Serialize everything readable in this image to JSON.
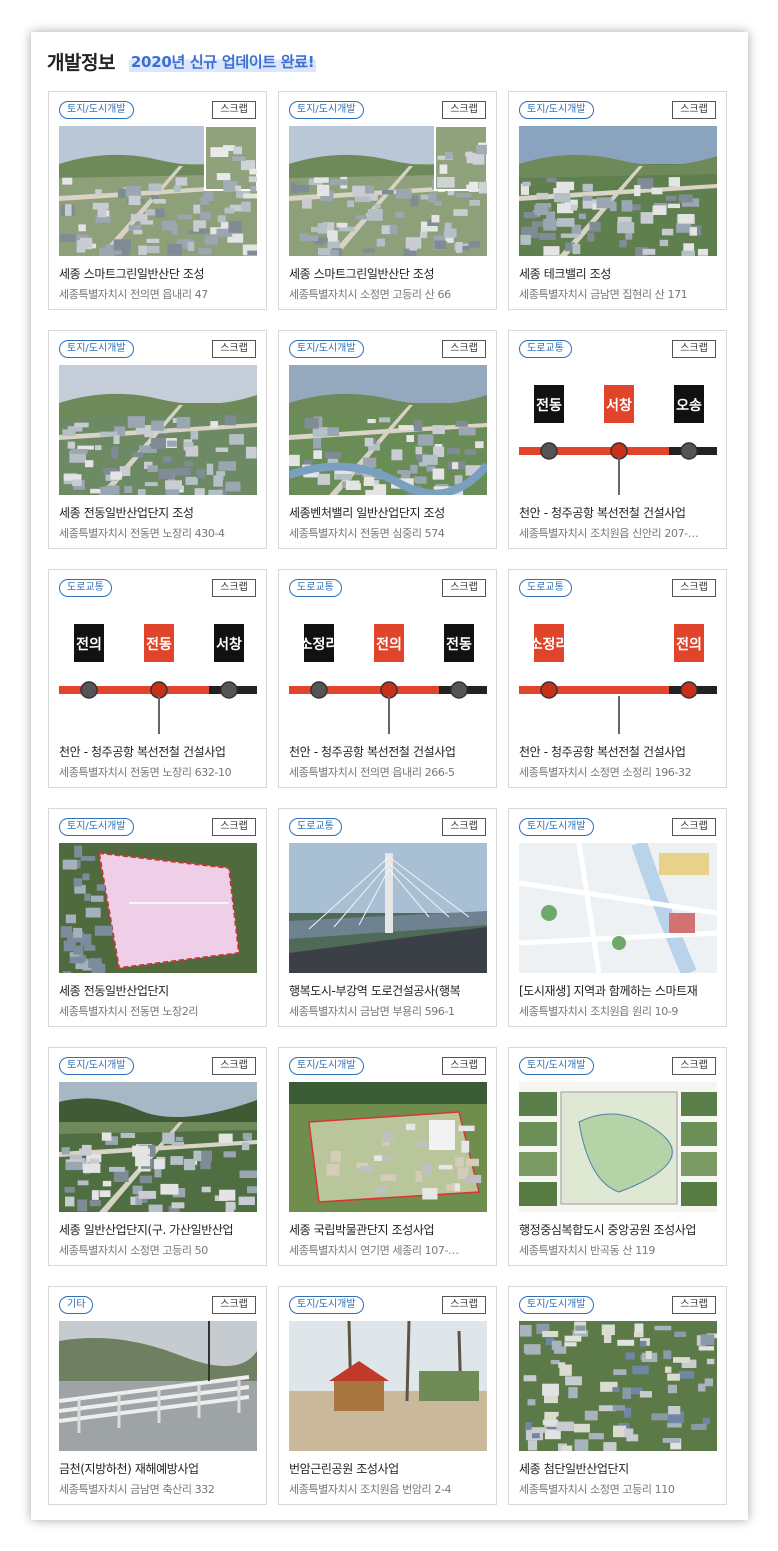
{
  "header": {
    "title": "개발정보",
    "notice": "2020년 신규 업데이트 완료!"
  },
  "scrap_label": "스크랩",
  "cards": [
    {
      "category": "토지/도시개발",
      "title": "세종 스마트그린일반산단 조성",
      "address": "세종특별자치시 전의면 읍내리 47",
      "thumb": "aerial-industrial-inset"
    },
    {
      "category": "토지/도시개발",
      "title": "세종 스마트그린일반산단 조성",
      "address": "세종특별자치시 소정면 고등리 산 66",
      "thumb": "aerial-industrial-inset"
    },
    {
      "category": "토지/도시개발",
      "title": "세종 테크밸리 조성",
      "address": "세종특별자치시 금남면 집현리 산 171",
      "thumb": "aerial-green-city"
    },
    {
      "category": "토지/도시개발",
      "title": "세종 전동일반산업단지 조성",
      "address": "세종특별자치시 전동면 노장리 430-4",
      "thumb": "aerial-industrial-hazy"
    },
    {
      "category": "토지/도시개발",
      "title": "세종벤처밸리 일반산업단지 조성",
      "address": "세종특별자치시 전동면 심중리 574",
      "thumb": "aerial-river-complex"
    },
    {
      "category": "도로교통",
      "title": "천안 - 청주공항 복선전철 건설사업",
      "address": "세종특별자치시 조치원읍 신안리 207-…",
      "thumb": "rail-map-a"
    },
    {
      "category": "도로교통",
      "title": "천안 - 청주공항 복선전철 건설사업",
      "address": "세종특별자치시 전동면 노장리 632-10",
      "thumb": "rail-map-b"
    },
    {
      "category": "도로교통",
      "title": "천안 - 청주공항 복선전철 건설사업",
      "address": "세종특별자치시 전의면 읍내리 266-5",
      "thumb": "rail-map-c"
    },
    {
      "category": "도로교통",
      "title": "천안 - 청주공항 복선전철 건설사업",
      "address": "세종특별자치시 소정면 소정리 196-32",
      "thumb": "rail-map-d"
    },
    {
      "category": "토지/도시개발",
      "title": "세종 전동일반산업단지",
      "address": "세종특별자치시 전동면 노장2리",
      "thumb": "site-plan-pink"
    },
    {
      "category": "도로교통",
      "title": "행복도시-부강역 도로건설공사(행복",
      "address": "세종특별자치시 금남면 부용리 596-1",
      "thumb": "cable-bridge"
    },
    {
      "category": "토지/도시개발",
      "title": "[도시재생] 지역과 함께하는 스마트재",
      "address": "세종특별자치시 조치원읍 원리 10-9",
      "thumb": "illustrated-map"
    },
    {
      "category": "토지/도시개발",
      "title": "세종 일반산업단지(구. 가산일반산업",
      "address": "세종특별자치시 소정면 고등리 50",
      "thumb": "aerial-valley"
    },
    {
      "category": "토지/도시개발",
      "title": "세종 국립박물관단지 조성사업",
      "address": "세종특별자치시 연기면 세종리 107-…",
      "thumb": "museum-plan"
    },
    {
      "category": "토지/도시개발",
      "title": "행정중심복합도시 중앙공원 조성사업",
      "address": "세종특별자치시 반곡동 산 119",
      "thumb": "park-plan-board"
    },
    {
      "category": "기타",
      "title": "금천(지방하천) 재해예방사업",
      "address": "세종특별자치시 금남면 축산리 332",
      "thumb": "river-guardrail"
    },
    {
      "category": "토지/도시개발",
      "title": "번암근린공원 조성사업",
      "address": "세종특별자치시 조치원읍 번암리 2-4",
      "thumb": "park-playground"
    },
    {
      "category": "토지/도시개발",
      "title": "세종 첨단일반산업단지",
      "address": "세종특별자치시 소정면 고등리 110",
      "thumb": "aerial-dense-industrial"
    }
  ],
  "rail_stations": {
    "rail-map-a": [
      "전동",
      "서창",
      "오송"
    ],
    "rail-map-b": [
      "전의",
      "전동",
      "서창"
    ],
    "rail-map-c": [
      "소정리",
      "전의",
      "전동"
    ],
    "rail-map-d": [
      "소정리",
      "전의"
    ]
  },
  "colors": {
    "tag_border": "#2f6fb6",
    "notice_text": "#3b6fd4",
    "notice_highlight": "#dce6fb",
    "rail_line": "#e0442a"
  }
}
